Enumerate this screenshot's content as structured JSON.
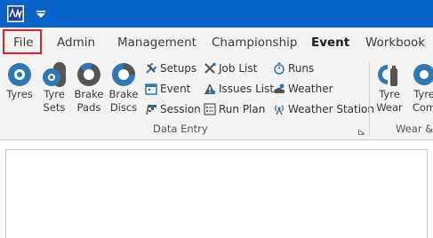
{
  "tabs": [
    "File",
    "Admin",
    "Management",
    "Championship",
    "Event",
    "Workbook"
  ],
  "active_tab": "Event",
  "ribbon": {
    "big_buttons": [
      {
        "line1": "Tyres",
        "line2": ""
      },
      {
        "line1": "Tyre",
        "line2": "Sets"
      },
      {
        "line1": "Brake",
        "line2": "Pads"
      },
      {
        "line1": "Brake",
        "line2": "Discs"
      }
    ],
    "col1": [
      "Setups",
      "Event",
      "Session"
    ],
    "col2": [
      "Job List",
      "Issues List",
      "Run Plan"
    ],
    "col3": [
      "Runs",
      "Weather",
      "Weather Station"
    ],
    "data_entry_label": "Data Entry",
    "wear_buttons": [
      {
        "line1": "Tyre",
        "line2": "Wear"
      },
      {
        "line1": "Tyre",
        "line2": "Com"
      }
    ],
    "wear_group_label": "Wear &"
  },
  "colors": {
    "titlebar": "#0a63c8",
    "ribbon": "#f3f3f3",
    "accent": "#2f77b5",
    "highlight": "#e31e24"
  }
}
